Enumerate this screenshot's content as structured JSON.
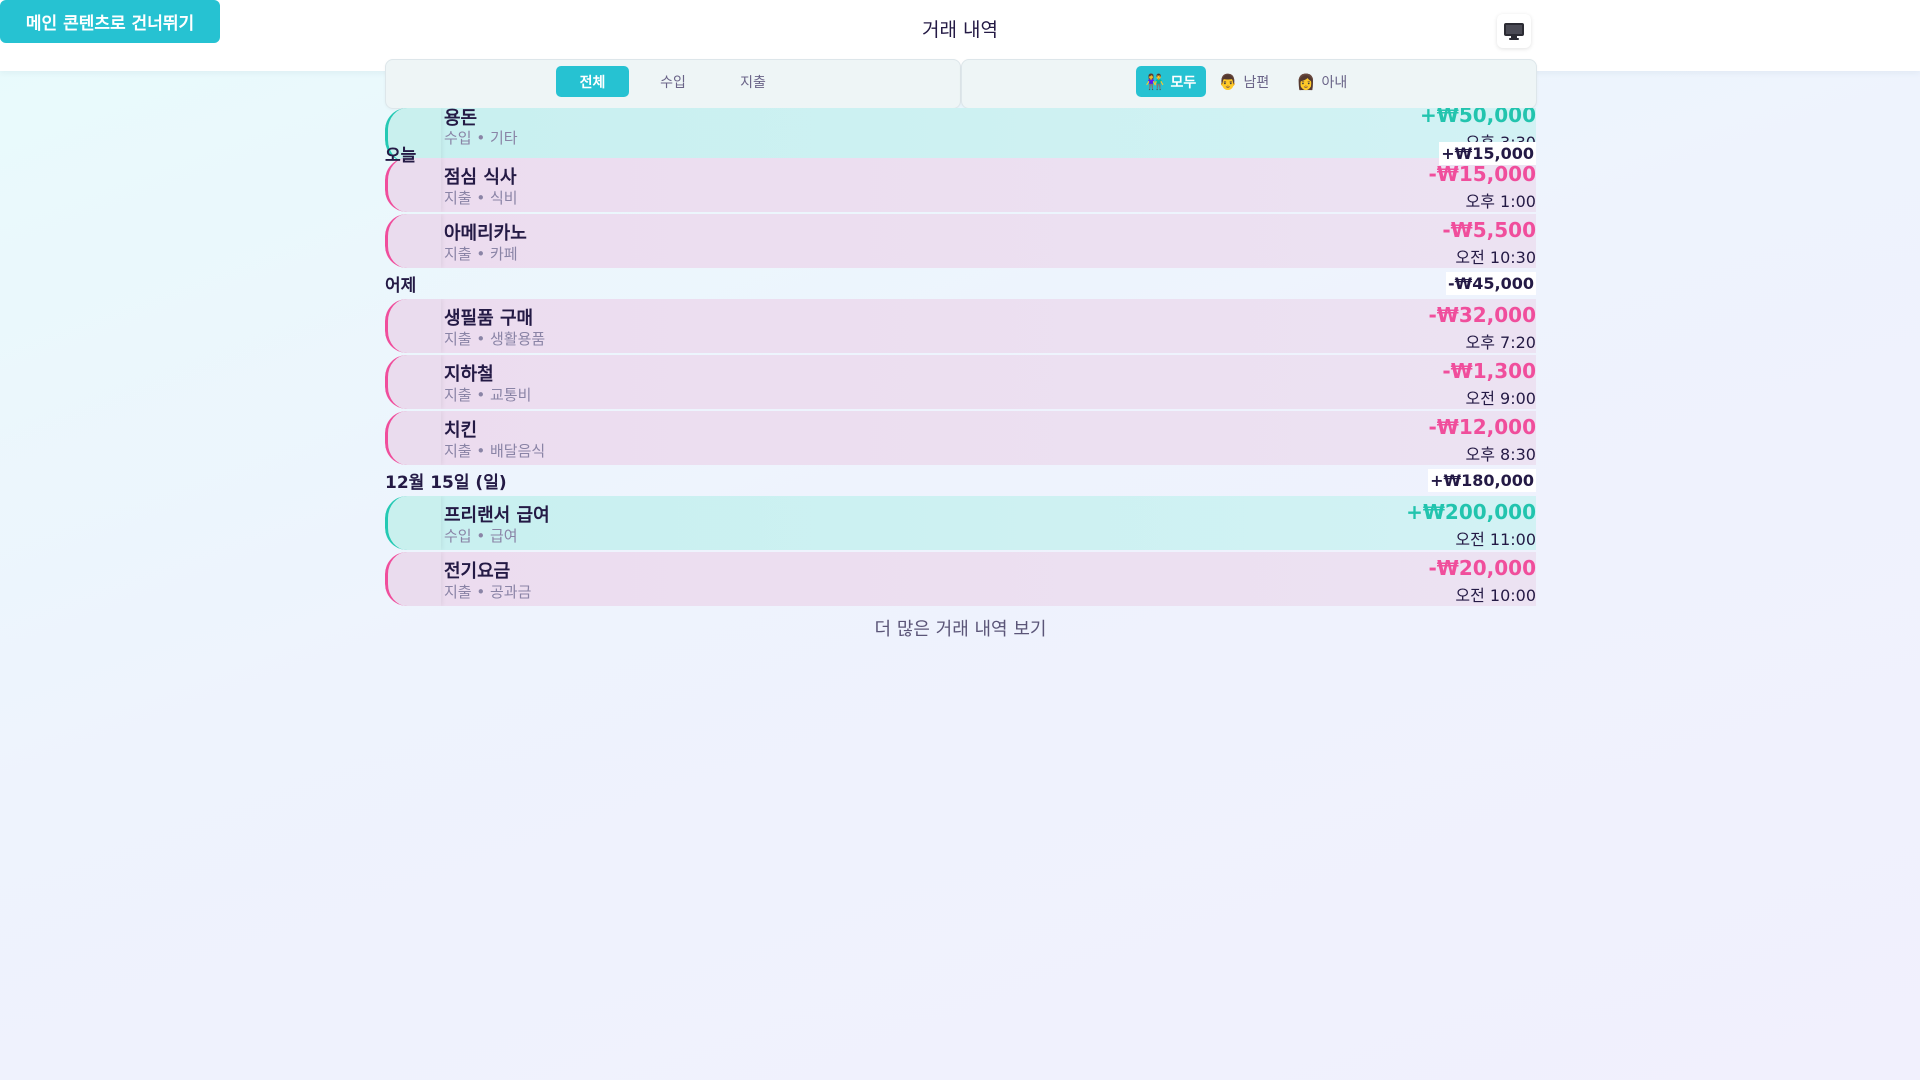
{
  "skip_link": "메인 콘텐츠로 건너뛰기",
  "header": {
    "title": "거래 내역",
    "monitor_icon": "monitor-icon"
  },
  "type_filter": {
    "all": "전체",
    "income": "수입",
    "expense": "지출",
    "selected": "전체"
  },
  "person_filter": {
    "all": "모두",
    "husband": "남편",
    "wife": "아내",
    "selected": "모두"
  },
  "sections": [
    {
      "label": "오늘",
      "total": "+₩15,000",
      "transactions": [
        {
          "kind": "income",
          "name": "용돈",
          "category": "수입 • 기타",
          "amount": "+₩50,000",
          "time": "오후 3:30"
        },
        {
          "kind": "expense",
          "name": "점심 식사",
          "category": "지출 • 식비",
          "amount": "-₩15,000",
          "time": "오후 1:00"
        },
        {
          "kind": "expense",
          "name": "아메리카노",
          "category": "지출 • 카페",
          "amount": "-₩5,500",
          "time": "오전 10:30"
        }
      ]
    },
    {
      "label": "어제",
      "total": "-₩45,000",
      "transactions": [
        {
          "kind": "expense",
          "name": "생필품 구매",
          "category": "지출 • 생활용품",
          "amount": "-₩32,000",
          "time": "오후 7:20"
        },
        {
          "kind": "expense",
          "name": "지하철",
          "category": "지출 • 교통비",
          "amount": "-₩1,300",
          "time": "오전 9:00"
        },
        {
          "kind": "expense",
          "name": "치킨",
          "category": "지출 • 배달음식",
          "amount": "-₩12,000",
          "time": "오후 8:30"
        }
      ]
    },
    {
      "label": "12월 15일 (일)",
      "total": "+₩180,000",
      "transactions": [
        {
          "kind": "income",
          "name": "프리랜서 급여",
          "category": "수입 • 급여",
          "amount": "+₩200,000",
          "time": "오전 11:00"
        },
        {
          "kind": "expense",
          "name": "전기요금",
          "category": "지출 • 공과금",
          "amount": "-₩20,000",
          "time": "오전 10:00"
        }
      ]
    }
  ],
  "more_link": "더 많은 거래 내역 보기",
  "colors": {
    "accent": "#26c2d2",
    "income": "#22c4ae",
    "expense": "#f04e9c",
    "text": "#241a45"
  }
}
